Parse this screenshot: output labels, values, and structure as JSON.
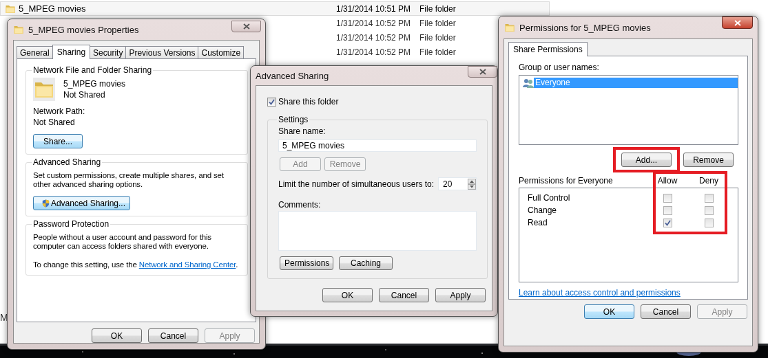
{
  "explorer": {
    "rows": [
      {
        "name": "5_MPEG movies",
        "date": "1/31/2014 10:51 PM",
        "type": "File folder",
        "selected": true
      },
      {
        "date": "1/31/2014 10:52 PM",
        "type": "File folder",
        "selected": false
      },
      {
        "date": "1/31/2014 10:52 PM",
        "type": "File folder",
        "selected": false
      },
      {
        "date": "1/31/2014 10:52 PM",
        "type": "File folder",
        "selected": false
      }
    ],
    "status_text": "M"
  },
  "properties_window": {
    "title": "5_MPEG movies Properties",
    "tabs": [
      {
        "label": "General",
        "selected": false
      },
      {
        "label": "Sharing",
        "selected": true
      },
      {
        "label": "Security",
        "selected": false
      },
      {
        "label": "Previous Versions",
        "selected": false
      },
      {
        "label": "Customize",
        "selected": false
      }
    ],
    "network_sharing": {
      "title": "Network File and Folder Sharing",
      "folder_name": "5_MPEG movies",
      "status": "Not Shared",
      "path_label": "Network Path:",
      "path_value": "Not Shared",
      "button": {
        "label": "Share...",
        "focused": true
      }
    },
    "advanced_sharing": {
      "title": "Advanced Sharing",
      "description": "Set custom permissions, create multiple shares, and set other advanced sharing options.",
      "button": {
        "label": "Advanced Sharing...",
        "focused": true
      }
    },
    "password_protection": {
      "title": "Password Protection",
      "description": "People without a user account and password for this computer can access folders shared with everyone.",
      "change_before": "To change this setting, use the ",
      "link": "Network and Sharing Center",
      "change_after": "."
    },
    "buttons": [
      {
        "label": "OK",
        "disabled": false,
        "focused": false
      },
      {
        "label": "Cancel",
        "disabled": false,
        "focused": false
      },
      {
        "label": "Apply",
        "disabled": true,
        "focused": false
      }
    ]
  },
  "advanced_sharing_window": {
    "title": "Advanced Sharing",
    "share_checkbox": {
      "label": "Share this folder",
      "checked": true
    },
    "settings": {
      "title": "Settings",
      "share_name_label": "Share name:",
      "share_name": "5_MPEG movies",
      "share_buttons": [
        {
          "label": "Add",
          "disabled": true
        },
        {
          "label": "Remove",
          "disabled": true
        }
      ],
      "limit_label": "Limit the number of simultaneous users to:",
      "limit_value": "20",
      "comments_label": "Comments:",
      "buttons": [
        {
          "label": "Permissions",
          "disabled": false
        },
        {
          "label": "Caching",
          "disabled": false
        }
      ]
    },
    "buttons": [
      {
        "label": "OK",
        "disabled": false,
        "focused": false
      },
      {
        "label": "Cancel",
        "disabled": false,
        "focused": false
      },
      {
        "label": "Apply",
        "disabled": false,
        "focused": false
      }
    ]
  },
  "permissions_window": {
    "title": "Permissions for 5_MPEG movies",
    "tabs": [
      {
        "label": "Share Permissions",
        "selected": true
      }
    ],
    "group_label": "Group or user names:",
    "users": [
      {
        "name": "Everyone",
        "selected": true
      }
    ],
    "user_buttons": [
      {
        "label": "Add...",
        "highlighted": true
      },
      {
        "label": "Remove",
        "highlighted": false
      }
    ],
    "permissions_label": "Permissions for Everyone",
    "allow_label": "Allow",
    "deny_label": "Deny",
    "columns_highlighted": true,
    "permissions": [
      {
        "name": "Full Control",
        "allow": false,
        "deny": false
      },
      {
        "name": "Change",
        "allow": false,
        "deny": false
      },
      {
        "name": "Read",
        "allow": true,
        "deny": false
      }
    ],
    "link": "Learn about access control and permissions",
    "buttons": [
      {
        "label": "OK",
        "disabled": false,
        "focused": true
      },
      {
        "label": "Cancel",
        "disabled": false,
        "focused": false
      },
      {
        "label": "Apply",
        "disabled": true,
        "focused": false
      }
    ]
  }
}
